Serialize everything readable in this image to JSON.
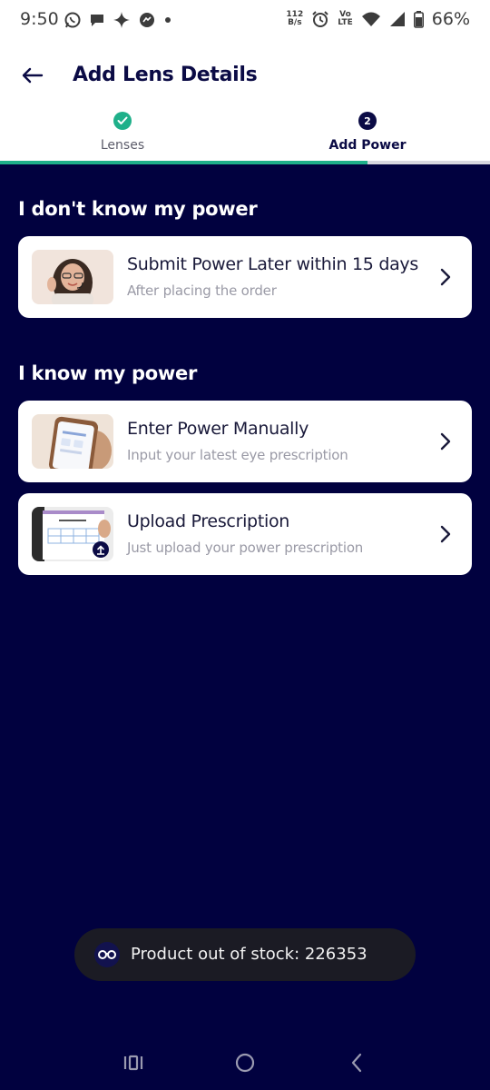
{
  "status_bar": {
    "time": "9:50",
    "net_speed_value": "112",
    "net_speed_unit": "B/s",
    "volte_top": "Vo",
    "volte_bottom": "LTE",
    "battery": "66%"
  },
  "header": {
    "title": "Add Lens Details",
    "steps": [
      {
        "label": "Lenses",
        "state": "done"
      },
      {
        "label": "Add Power",
        "number": "2",
        "state": "active"
      }
    ],
    "progress_fraction": 0.75
  },
  "sections": [
    {
      "title": "I don't know my power",
      "cards": [
        {
          "title": "Submit Power Later within 15 days",
          "subtitle": "After placing the order",
          "thumbnail": "support-agent-image"
        }
      ]
    },
    {
      "title": "I know my power",
      "cards": [
        {
          "title": "Enter Power Manually",
          "subtitle": "Input your latest eye prescription",
          "thumbnail": "phone-in-hand-image"
        },
        {
          "title": "Upload Prescription",
          "subtitle": "Just upload your power prescription",
          "thumbnail": "prescription-paper-image"
        }
      ]
    }
  ],
  "toast": {
    "text": "Product out of stock: 226353",
    "icon": "glasses-icon"
  },
  "colors": {
    "background": "#01013f",
    "accent_green": "#1fb08a",
    "primary_navy": "#0b0b45"
  }
}
